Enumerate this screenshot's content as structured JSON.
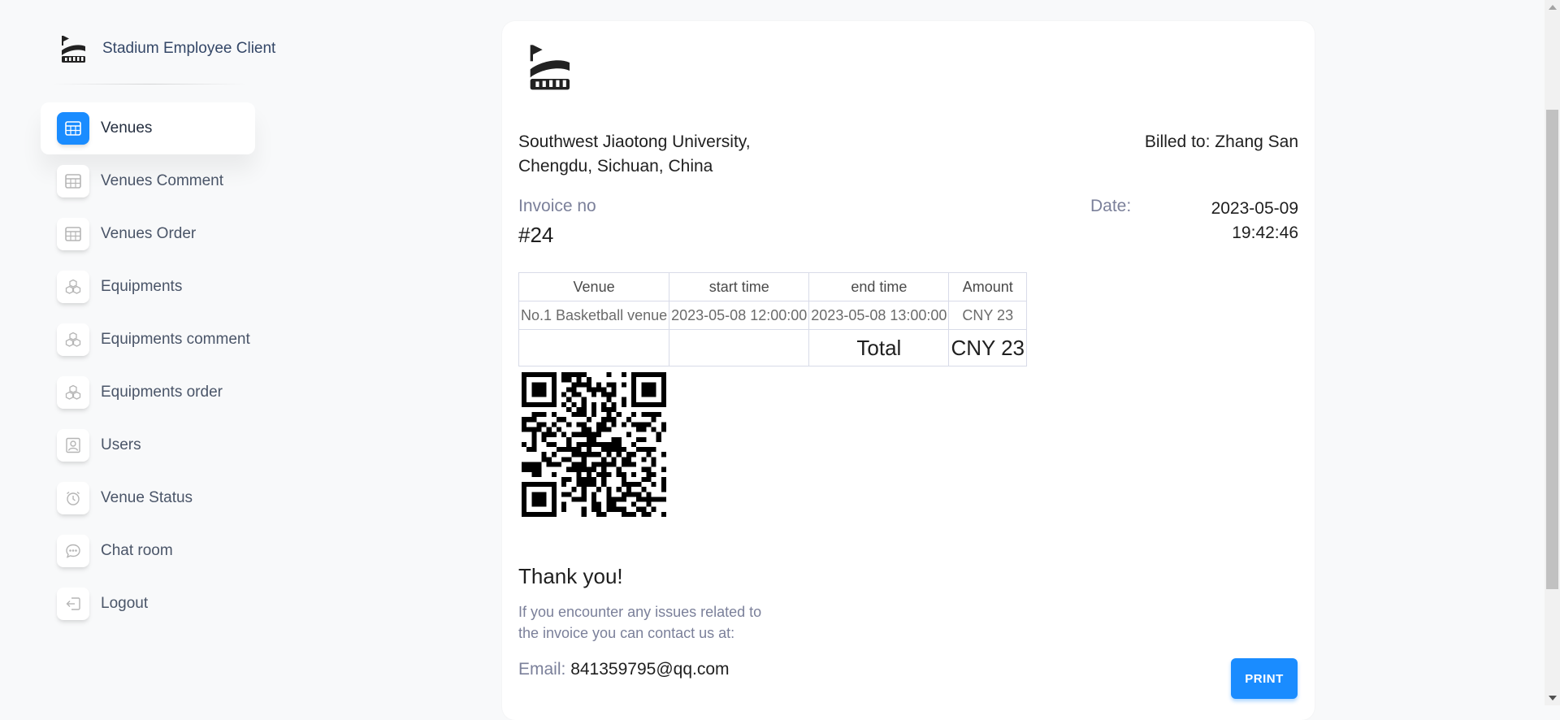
{
  "brand": {
    "name": "Stadium Employee Client",
    "icon": "stadium-icon"
  },
  "sidebar": {
    "items": [
      {
        "label": "Venues",
        "icon": "table-icon",
        "active": true
      },
      {
        "label": "Venues Comment",
        "icon": "table-icon",
        "active": false
      },
      {
        "label": "Venues Order",
        "icon": "table-icon",
        "active": false
      },
      {
        "label": "Equipments",
        "icon": "cubes-icon",
        "active": false
      },
      {
        "label": "Equipments comment",
        "icon": "cubes-icon",
        "active": false
      },
      {
        "label": "Equipments order",
        "icon": "cubes-icon",
        "active": false
      },
      {
        "label": "Users",
        "icon": "user-card-icon",
        "active": false
      },
      {
        "label": "Venue Status",
        "icon": "alarm-clock-icon",
        "active": false
      },
      {
        "label": "Chat room",
        "icon": "chat-bubble-icon",
        "active": false
      },
      {
        "label": "Logout",
        "icon": "logout-icon",
        "active": false
      }
    ]
  },
  "invoice": {
    "address_line1": "Southwest Jiaotong University,",
    "address_line2": "Chengdu, Sichuan, China",
    "billed_to": "Billed to: Zhang San",
    "invoice_label": "Invoice no",
    "invoice_number": "#24",
    "date_label": "Date:",
    "date_day": "2023-05-09",
    "date_time": "19:42:46",
    "table": {
      "headers": [
        "Venue",
        "start time",
        "end time",
        "Amount"
      ],
      "rows": [
        [
          "No.1 Basketball venue",
          "2023-05-08 12:00:00",
          "2023-05-08 13:00:00",
          "CNY 23"
        ]
      ],
      "total_label": "Total",
      "total_value": "CNY 23"
    },
    "thanks": "Thank you!",
    "contact_text": "If you encounter any issues related to the invoice you can contact us at:",
    "email_label": "Email:",
    "email_value": "841359795@qq.com",
    "print_label": "PRINT"
  },
  "colors": {
    "accent": "#1a8cff",
    "background": "#f8f9fa",
    "card": "#ffffff"
  }
}
